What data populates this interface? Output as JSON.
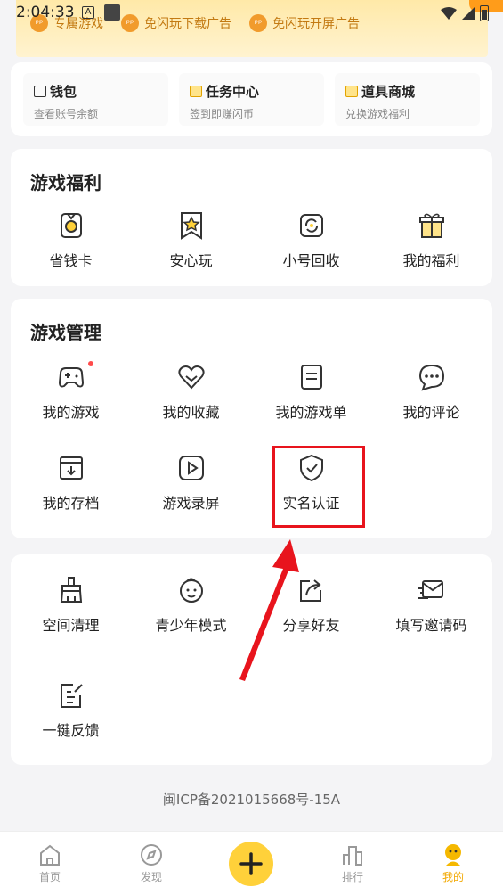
{
  "status": {
    "time": "2:04:33",
    "indicator": "A"
  },
  "promos": [
    {
      "label": "专属游戏"
    },
    {
      "label": "免闪玩下载广告"
    },
    {
      "label": "免闪玩开屏广告"
    }
  ],
  "promo_icon_text": "ᵖᵖ",
  "wallet": [
    {
      "title": "钱包",
      "sub": "查看账号余额"
    },
    {
      "title": "任务中心",
      "sub": "签到即赚闪币"
    },
    {
      "title": "道具商城",
      "sub": "兑换游戏福利"
    }
  ],
  "benefits": {
    "title": "游戏福利",
    "items": [
      {
        "label": "省钱卡",
        "icon": "savings-card-icon"
      },
      {
        "label": "安心玩",
        "icon": "star-badge-icon"
      },
      {
        "label": "小号回收",
        "icon": "recycle-icon"
      },
      {
        "label": "我的福利",
        "icon": "gift-icon"
      }
    ]
  },
  "management": {
    "title": "游戏管理",
    "items": [
      {
        "label": "我的游戏",
        "icon": "gamepad-icon"
      },
      {
        "label": "我的收藏",
        "icon": "heart-icon"
      },
      {
        "label": "我的游戏单",
        "icon": "list-icon"
      },
      {
        "label": "我的评论",
        "icon": "comment-icon"
      },
      {
        "label": "我的存档",
        "icon": "archive-icon"
      },
      {
        "label": "游戏录屏",
        "icon": "play-icon"
      },
      {
        "label": "实名认证",
        "icon": "shield-check-icon"
      }
    ]
  },
  "tools": {
    "items": [
      {
        "label": "空间清理",
        "icon": "broom-icon"
      },
      {
        "label": "青少年模式",
        "icon": "child-face-icon"
      },
      {
        "label": "分享好友",
        "icon": "share-icon"
      },
      {
        "label": "填写邀请码",
        "icon": "envelope-icon"
      },
      {
        "label": "一键反馈",
        "icon": "feedback-icon"
      }
    ]
  },
  "icp": "闽ICP备2021015668号-15A",
  "tabs": [
    {
      "label": "首页",
      "icon": "home-icon"
    },
    {
      "label": "发现",
      "icon": "compass-icon"
    },
    {
      "label": "排行",
      "icon": "ranking-icon"
    },
    {
      "label": "我的",
      "icon": "profile-icon",
      "active": true
    }
  ],
  "colors": {
    "accent": "#ffd13a",
    "highlight": "#e8141d",
    "active_tab": "#f2a800"
  }
}
